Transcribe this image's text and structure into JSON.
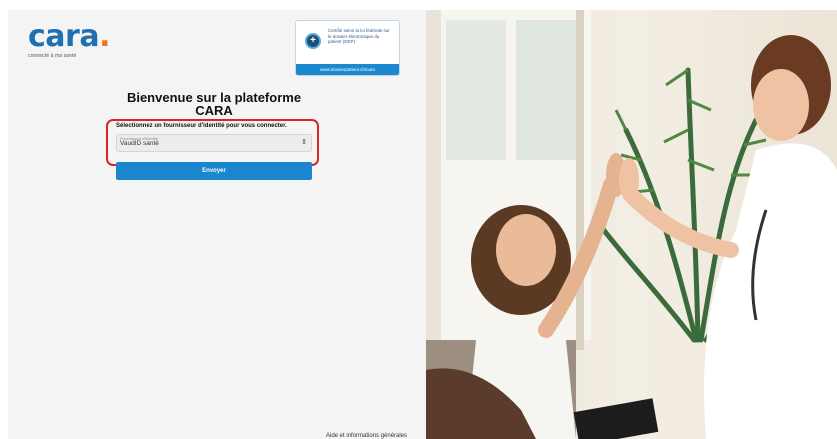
{
  "brand": {
    "name": "cara",
    "dot": ".",
    "tagline": "connecté à ma santé",
    "primary_color": "#1f6fb2",
    "accent_color": "#e87722"
  },
  "certification": {
    "icon": "shield-cross-icon",
    "text": "Certifié selon la loi fédérale sur le dossier électronique du patient (DEP)",
    "link": "www.dossierpatient.ch/cara"
  },
  "login": {
    "title": "Bienvenue sur la plateforme CARA",
    "select_label": "Sélectionnez un fournisseur d'identité pour vous connecter.",
    "select_placeholder": "Fournisseur d'identité",
    "select_value": "VaudID santé",
    "submit_label": "Envoyer",
    "button_color": "#1a86ce",
    "highlight_color": "#d9252a"
  },
  "footer": {
    "link": "Aide et informations générales"
  },
  "hero": {
    "image": "doctor-girl-high-five-photo"
  }
}
